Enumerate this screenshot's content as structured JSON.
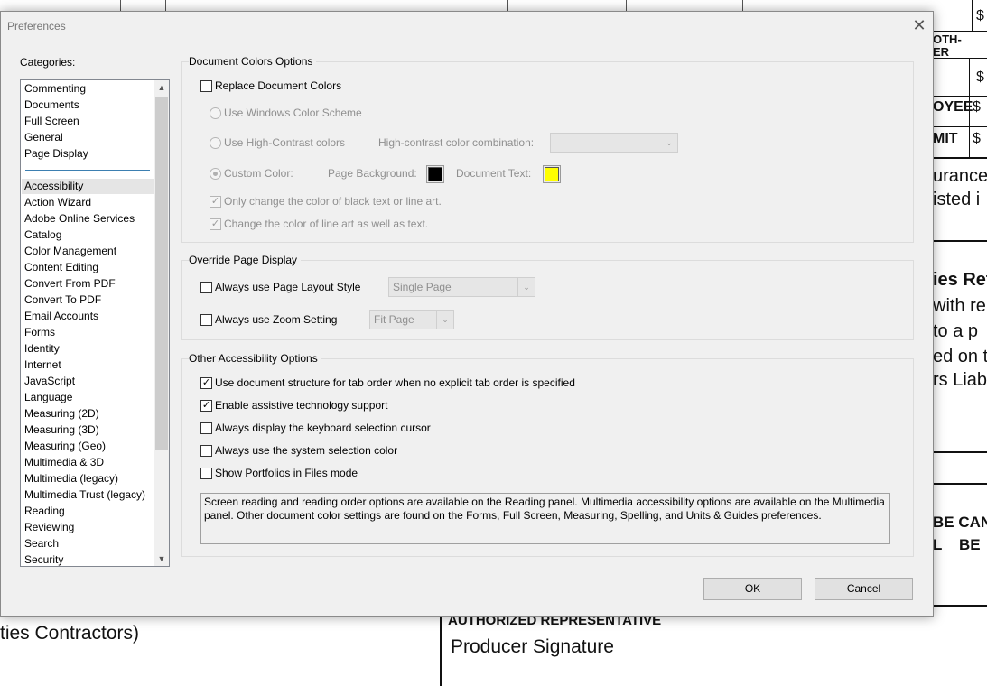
{
  "window": {
    "title": "Preferences",
    "close_glyph": "✕"
  },
  "categories": {
    "label": "Categories:",
    "top_items": [
      "Commenting",
      "Documents",
      "Full Screen",
      "General",
      "Page Display"
    ],
    "items": [
      "Accessibility",
      "Action Wizard",
      "Adobe Online Services",
      "Catalog",
      "Color Management",
      "Content Editing",
      "Convert From PDF",
      "Convert To PDF",
      "Email Accounts",
      "Forms",
      "Identity",
      "Internet",
      "JavaScript",
      "Language",
      "Measuring (2D)",
      "Measuring (3D)",
      "Measuring (Geo)",
      "Multimedia & 3D",
      "Multimedia (legacy)",
      "Multimedia Trust (legacy)",
      "Reading",
      "Reviewing",
      "Search",
      "Security"
    ],
    "selected": "Accessibility"
  },
  "doc_colors": {
    "title": "Document Colors Options",
    "replace_label": "Replace Document Colors",
    "replace_checked": false,
    "windows_scheme_label": "Use Windows Color Scheme",
    "high_contrast_label": "Use High-Contrast colors",
    "hc_combo_label": "High-contrast color combination:",
    "hc_combo_value": "",
    "custom_label": "Custom Color:",
    "custom_selected": true,
    "page_bg_label": "Page Background:",
    "page_bg_color": "#000000",
    "doc_text_label": "Document Text:",
    "doc_text_color": "#ffff00",
    "black_text_label": "Only change the color of black text or line art.",
    "black_text_checked": true,
    "line_art_label": "Change the color of line art as well as text.",
    "line_art_checked": true
  },
  "override": {
    "title": "Override Page Display",
    "layout_label": "Always use Page Layout Style",
    "layout_checked": false,
    "layout_value": "Single Page",
    "zoom_label": "Always use Zoom Setting",
    "zoom_checked": false,
    "zoom_value": "Fit Page"
  },
  "other": {
    "title": "Other Accessibility Options",
    "options": [
      {
        "label": "Use document structure for tab order when no explicit tab order is specified",
        "checked": true
      },
      {
        "label": "Enable assistive technology support",
        "checked": true
      },
      {
        "label": "Always display the keyboard selection cursor",
        "checked": false
      },
      {
        "label": "Always use the system selection color",
        "checked": false
      },
      {
        "label": "Show Portfolios in Files mode",
        "checked": false
      }
    ],
    "note": "Screen reading and reading order options are available on the Reading panel. Multimedia accessibility options are available on the Multimedia panel. Other document color settings are found on the Forms, Full Screen, Measuring, Spelling, and Units & Guides preferences."
  },
  "buttons": {
    "ok": "OK",
    "cancel": "Cancel"
  },
  "background_doc": {
    "right_fragments": [
      "$",
      "OTH-",
      "ER",
      "$",
      "OYEE",
      "$",
      "MIT",
      "$",
      "urance",
      "isted i",
      "ies Ret",
      "with re",
      "to a p",
      "ed on th",
      "rs Liab",
      "BE CAN",
      "L    BE"
    ],
    "bottom_left": "ties Contractors)",
    "authorized": "AUTHORIZED REPRESENTATIVE",
    "producer": "Producer Signature"
  },
  "icons": {
    "checkmark": "✓",
    "arrow_up": "▲",
    "arrow_down": "▼",
    "combo_arrow": "⌄"
  }
}
